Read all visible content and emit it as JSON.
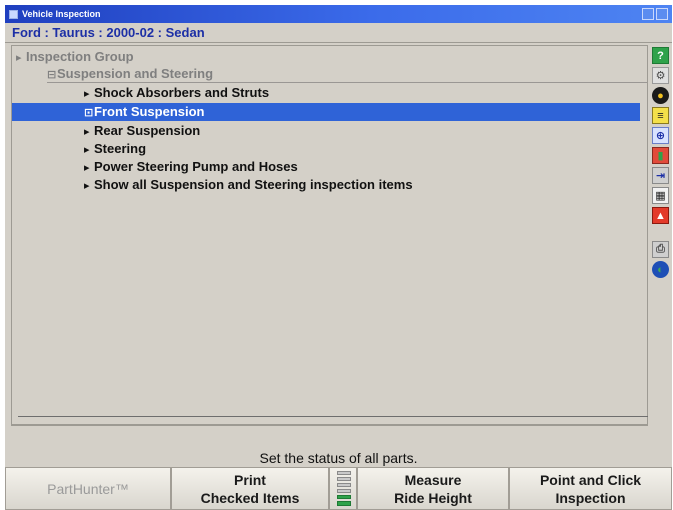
{
  "window": {
    "title": "Vehicle Inspection",
    "vehicle": "Ford : Taurus : 2000-02 : Sedan"
  },
  "tree": {
    "root": "Inspection Group",
    "group": "Suspension and Steering",
    "items": [
      {
        "label": "Shock Absorbers and Struts"
      },
      {
        "label": "Front Suspension"
      },
      {
        "label": "Rear Suspension"
      },
      {
        "label": "Steering"
      },
      {
        "label": "Power Steering Pump and Hoses"
      },
      {
        "label": "Show all Suspension and Steering inspection items"
      }
    ],
    "selected_index": 1
  },
  "toolbar_icons": [
    "help-icon",
    "inspection-tool-icon",
    "tire-icon",
    "specs-icon",
    "alignment-icon",
    "flags-icon",
    "ruler-icon",
    "calendar-icon",
    "warning-icon",
    "printer-icon",
    "globe-icon"
  ],
  "status": {
    "message": "Set the status of all parts."
  },
  "softkeys": {
    "parthunter": "PartHunter™",
    "print_line1": "Print",
    "print_line2": "Checked Items",
    "measure_line1": "Measure",
    "measure_line2": "Ride Height",
    "point_line1": "Point and Click",
    "point_line2": "Inspection"
  },
  "colors": {
    "selection": "#2f63d7",
    "vehicle_text": "#1c2fa6",
    "titlebar": "#3b6bea"
  }
}
